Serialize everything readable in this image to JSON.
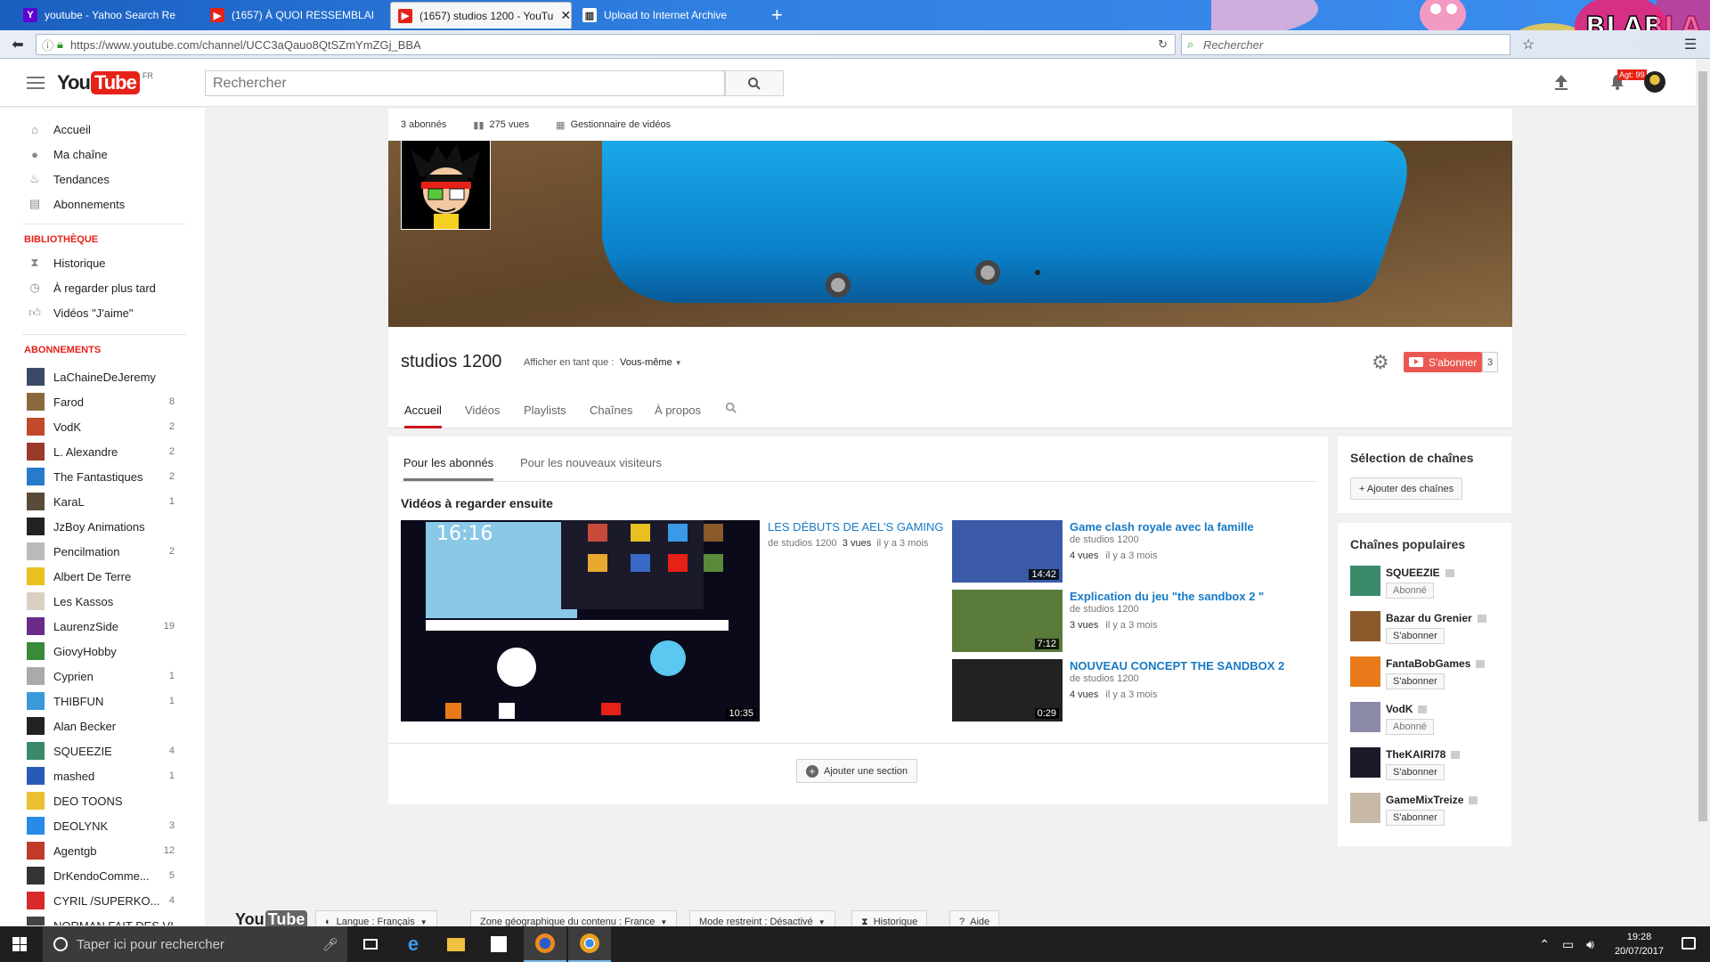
{
  "browser": {
    "tabs": [
      {
        "title": "youtube - Yahoo Search Re",
        "active": false,
        "favicon": "Y"
      },
      {
        "title": "(1657) À QUOI RESSEMBLAI",
        "active": false,
        "favicon": "yt"
      },
      {
        "title": "(1657) studios 1200 - YouTu",
        "active": true,
        "favicon": "yt"
      },
      {
        "title": "Upload to Internet Archive",
        "active": false,
        "favicon": "ia"
      }
    ],
    "url": "https://www.youtube.com/channel/UCC3aQauo8QtSZmYmZGj_BBA",
    "search_placeholder": "Rechercher",
    "theme_art_text": "BLABLA"
  },
  "header": {
    "logo_you": "You",
    "logo_tube": "Tube",
    "logo_region": "FR",
    "search_placeholder": "Rechercher",
    "notifications_count": "Agt: 99"
  },
  "sidebar": {
    "main": [
      {
        "label": "Accueil",
        "icon": "home-icon"
      },
      {
        "label": "Ma chaîne",
        "icon": "user-icon"
      },
      {
        "label": "Tendances",
        "icon": "flame-icon"
      },
      {
        "label": "Abonnements",
        "icon": "subscriptions-icon"
      }
    ],
    "library_title": "BIBLIOTHÈQUE",
    "library": [
      {
        "label": "Historique",
        "icon": "hourglass-icon"
      },
      {
        "label": "À regarder plus tard",
        "icon": "clock-icon"
      },
      {
        "label": "Vidéos \"J'aime\"",
        "icon": "thumbs-up-icon"
      }
    ],
    "subs_title": "ABONNEMENTS",
    "subscriptions": [
      {
        "label": "LaChaineDeJeremy",
        "count": "",
        "color": "#3a4a66"
      },
      {
        "label": "Farod",
        "count": "8",
        "color": "#8a6a3c"
      },
      {
        "label": "VodK",
        "count": "2",
        "color": "#c04a2a"
      },
      {
        "label": "L. Alexandre",
        "count": "2",
        "color": "#9a3a2a"
      },
      {
        "label": "The Fantastiques",
        "count": "2",
        "color": "#2a7acc"
      },
      {
        "label": "KaraL",
        "count": "1",
        "color": "#5a4a3a"
      },
      {
        "label": "JzBoy Animations",
        "count": "",
        "color": "#222222"
      },
      {
        "label": "Pencilmation",
        "count": "2",
        "color": "#bbbbbb"
      },
      {
        "label": "Albert De Terre",
        "count": "",
        "color": "#e8c020"
      },
      {
        "label": "Les Kassos",
        "count": "",
        "color": "#d8d0c0"
      },
      {
        "label": "LaurenzSide",
        "count": "19",
        "color": "#6a2a8a"
      },
      {
        "label": "GiovyHobby",
        "count": "",
        "color": "#3a8a3a"
      },
      {
        "label": "Cyprien",
        "count": "1",
        "color": "#aaaaaa"
      },
      {
        "label": "THIBFUN",
        "count": "1",
        "color": "#3a9ad8"
      },
      {
        "label": "Alan Becker",
        "count": "",
        "color": "#222222"
      },
      {
        "label": "SQUEEZIE",
        "count": "4",
        "color": "#3a8a6a"
      },
      {
        "label": "mashed",
        "count": "1",
        "color": "#2a5ab8"
      },
      {
        "label": "DEO TOONS",
        "count": "",
        "color": "#e8c030"
      },
      {
        "label": "DEOLYNK",
        "count": "3",
        "color": "#2a8ae8"
      },
      {
        "label": "Agentgb",
        "count": "12",
        "color": "#c03a2a"
      },
      {
        "label": "DrKendoComme...",
        "count": "5",
        "color": "#333333"
      },
      {
        "label": "CYRIL /SUPERKO...",
        "count": "4",
        "color": "#d82a2a"
      },
      {
        "label": "NORMAN FAIT DES VI...",
        "count": "",
        "color": "#444444"
      }
    ]
  },
  "channel": {
    "stats": {
      "subscribers": "3 abonnés",
      "views": "275 vues",
      "manager": "Gestionnaire de vidéos"
    },
    "name": "studios 1200",
    "view_as_label": "Afficher en tant que :",
    "view_as_value": "Vous-même",
    "subscribe_label": "S'abonner",
    "subscriber_count": "3",
    "tabs": [
      "Accueil",
      "Vidéos",
      "Playlists",
      "Chaînes",
      "À propos"
    ],
    "active_tab": "Accueil"
  },
  "main": {
    "sub_tabs": [
      "Pour les abonnés",
      "Pour les nouveaux visiteurs"
    ],
    "section_title": "Vidéos à regarder ensuite",
    "featured": {
      "title": "LES DÉBUTS DE AEL'S GAMING",
      "by": "de studios 1200",
      "views": "3 vues",
      "age": "il y a 3 mois",
      "duration": "10:35",
      "clock": "16:16"
    },
    "videos": [
      {
        "title": "Game clash royale avec la famille",
        "by": "de studios 1200",
        "views": "4 vues",
        "age": "il y a 3 mois",
        "duration": "14:42",
        "color": "#3a5aa8"
      },
      {
        "title": "Explication du jeu \"the sandbox 2 \"",
        "by": "de studios 1200",
        "views": "3 vues",
        "age": "il y a 3 mois",
        "duration": "7:12",
        "color": "#5a7a3a"
      },
      {
        "title": "NOUVEAU CONCEPT THE SANDBOX 2",
        "by": "de studios 1200",
        "views": "4 vues",
        "age": "il y a 3 mois",
        "duration": "0:29",
        "color": "#222222"
      }
    ],
    "add_section_label": "Ajouter une section"
  },
  "right": {
    "selection_title": "Sélection de chaînes",
    "add_channels_label": "+ Ajouter des chaînes",
    "popular_title": "Chaînes populaires",
    "popular": [
      {
        "name": "SQUEEZIE",
        "button": "Abonné",
        "subscribed": true,
        "color": "#3a8a6a"
      },
      {
        "name": "Bazar du Grenier",
        "button": "S'abonner",
        "subscribed": false,
        "color": "#8a5a2a"
      },
      {
        "name": "FantaBobGames",
        "button": "S'abonner",
        "subscribed": false,
        "color": "#e87a1a"
      },
      {
        "name": "VodK",
        "button": "Abonné",
        "subscribed": true,
        "color": "#8a8aa8"
      },
      {
        "name": "TheKAIRI78",
        "button": "S'abonner",
        "subscribed": false,
        "color": "#1a1a2a"
      },
      {
        "name": "GameMixTreize",
        "button": "S'abonner",
        "subscribed": false,
        "color": "#c8b8a8"
      }
    ]
  },
  "footer": {
    "logo_you": "You",
    "logo_tube": "Tube",
    "buttons": [
      "Langue : Français",
      "Zone géographique du contenu : France",
      "Mode restreint : Désactivé",
      "Historique",
      "Aide"
    ]
  },
  "taskbar": {
    "search_placeholder": "Taper ici pour rechercher",
    "time": "19:28",
    "date": "20/07/2017"
  }
}
